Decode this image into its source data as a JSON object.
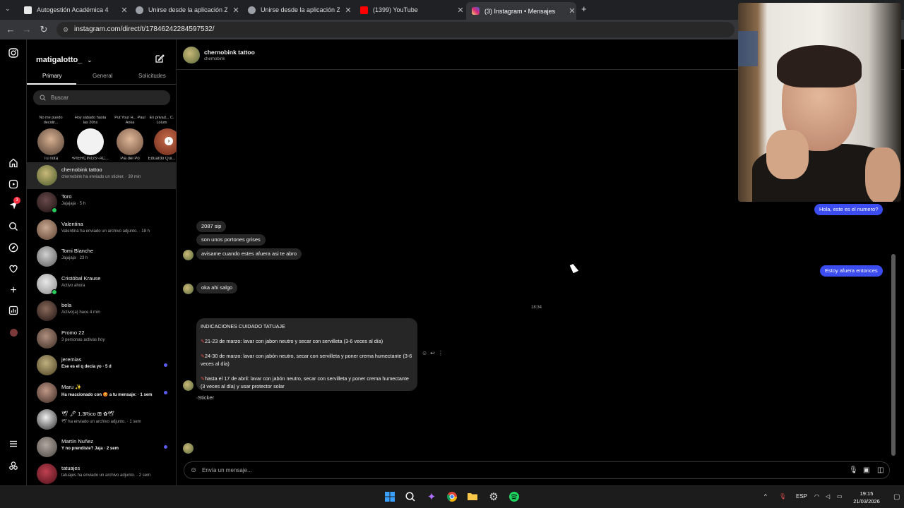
{
  "browser": {
    "tabs": [
      {
        "title": "Autogestión Académica 4",
        "fav_color": "#e8e8e8"
      },
      {
        "title": "Unirse desde la aplicación Zoom",
        "fav_color": "#9aa0a6"
      },
      {
        "title": "Unirse desde la aplicación Zoom",
        "fav_color": "#9aa0a6"
      },
      {
        "title": "(1399) YouTube",
        "fav_color": "#ff0000"
      },
      {
        "title": "(3) Instagram • Mensajes",
        "fav_color": "#d6249f"
      }
    ],
    "url": "instagram.com/direct/t/17846242284597532/"
  },
  "sidebar": {
    "username": "matigalotto_",
    "tabs": {
      "primary": "Primary",
      "general": "General",
      "requests": "Solicitudes"
    },
    "search_placeholder": "Buscar",
    "notes": [
      {
        "bubble": "No me puedo decidir...",
        "name": "Tu nota",
        "color": "#5a4a40"
      },
      {
        "bubble": "Hoy sábado hasta las 20hs",
        "name": "•PIERCINGS~AC...",
        "color": "#f2f2f2"
      },
      {
        "bubble": "Put Your H... Paul Anka",
        "name": "Pia del Pó",
        "color": "#c89a7a"
      },
      {
        "bubble": "En privad... C. Lolum",
        "name": "Eduardo Qui...",
        "color": "#a83a2a"
      }
    ],
    "conversations": [
      {
        "name": "chernobink tattoo",
        "preview": "chernobink ha enviado un sticker. · 39 min",
        "bold": false,
        "unread": false,
        "online": false,
        "color": "#8a9a5a"
      },
      {
        "name": "Toro",
        "preview": "Jajajaja · 5 h",
        "bold": false,
        "unread": false,
        "online": true,
        "color": "#3a2a2a"
      },
      {
        "name": "Valentina",
        "preview": "Valentina ha enviado un archivo adjunto. · 18 h",
        "bold": false,
        "unread": false,
        "online": false,
        "color": "#8a7060"
      },
      {
        "name": "Tomi Blanche",
        "preview": "Jajajaja · 23 h",
        "bold": false,
        "unread": false,
        "online": false,
        "color": "#9a9a9a"
      },
      {
        "name": "Cristóbal Krause",
        "preview": "Activo ahora",
        "bold": false,
        "unread": false,
        "online": true,
        "color": "#c8c8c8"
      },
      {
        "name": "bela",
        "preview": "Activo(a) hace 4 min",
        "bold": false,
        "unread": false,
        "online": false,
        "color": "#4a3a3a"
      },
      {
        "name": "Promo 22",
        "preview": "3 personas activas hoy",
        "bold": false,
        "unread": false,
        "online": false,
        "color": "#6a5a50"
      },
      {
        "name": "jeremias",
        "preview": "Ese es el q decía yo · 5 d",
        "bold": true,
        "unread": true,
        "online": false,
        "color": "#8a8050"
      },
      {
        "name": "Maru ✨",
        "preview": "Ha reaccionado con 😡 a tu mensaje: · 1 sem",
        "bold": true,
        "unread": true,
        "online": false,
        "color": "#6a5048"
      },
      {
        "name": "🕊 🖋 1.3Rico ⊞ ✿🕊",
        "preview": "🕊 ha enviado un archivo adjunto. · 1 sem",
        "bold": false,
        "unread": false,
        "online": false,
        "color": "#e8e8e8"
      },
      {
        "name": "Martín Nuñez",
        "preview": "Y no prendiste? Jaja · 2 sem",
        "bold": true,
        "unread": true,
        "online": false,
        "color": "#7a7068"
      },
      {
        "name": "tatuajes",
        "preview": "tatuajes ha enviado un archivo adjunto. · 2 sem",
        "bold": false,
        "unread": false,
        "online": false,
        "color": "#9a3040"
      }
    ]
  },
  "rail": {
    "badge": "3"
  },
  "chat": {
    "header": {
      "name": "chernobink tattoo",
      "handle": "chernobink"
    },
    "messages": {
      "m1": "Hola, este es el numero?",
      "m2": "2087 sip",
      "m3": "son unos portones grises",
      "m4": "avisame cuando estes afuera asi te abro",
      "m5": "Estoy afuera entonces",
      "m6": "oka ahi salgo",
      "timestamp": "18:34",
      "long_title": "INDICACIONES CUIDADO TATUAJE",
      "long_p1": "21-23 de marzo: lavar con jabon neutro y secar con servilleta (3-6 veces al día)",
      "long_p2": "24-30 de marzo: lavar con jabón neutro, secar con servilleta y poner crema humectante (3-6 veces al día)",
      "long_p3": "hasta el 17 de abril: lavar con jabón neutro, secar con servilleta y poner crema humectante (3 veces al día) y usar protector solar",
      "sticker": "Sticker"
    },
    "composer_placeholder": "Envía un mensaje..."
  },
  "taskbar": {
    "lang": "ESP",
    "time": "19:15",
    "date": "21/03/2026"
  }
}
